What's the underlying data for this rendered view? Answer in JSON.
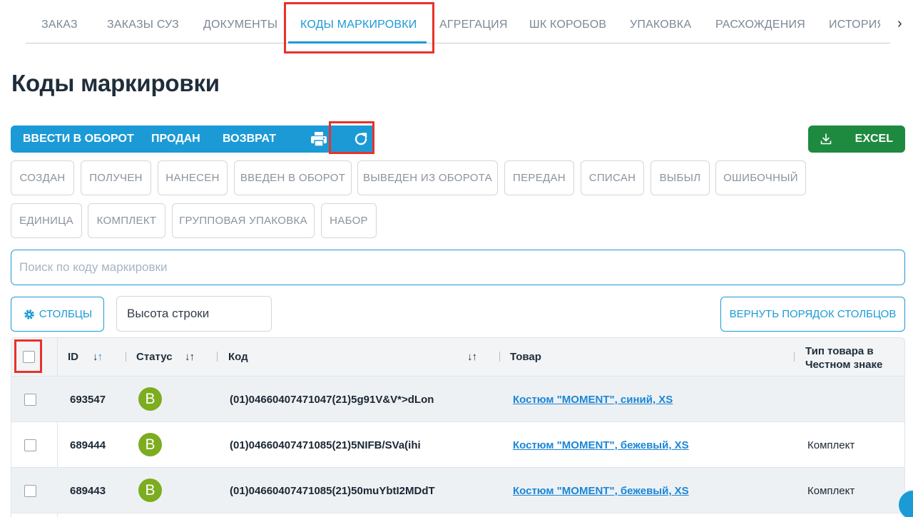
{
  "tabs": [
    {
      "label": "ЗАКАЗ"
    },
    {
      "label": "ЗАКАЗЫ СУЗ"
    },
    {
      "label": "ДОКУМЕНТЫ"
    },
    {
      "label": "КОДЫ МАРКИРОВКИ",
      "active": true
    },
    {
      "label": "АГРЕГАЦИЯ"
    },
    {
      "label": "ШК КОРОБОВ"
    },
    {
      "label": "УПАКОВКА"
    },
    {
      "label": "РАСХОЖДЕНИЯ"
    },
    {
      "label": "ИСТОРИЯ И"
    }
  ],
  "page_title": "Коды маркировки",
  "actions": {
    "enter_circulation": "ВВЕСТИ В ОБОРОТ",
    "sold": "ПРОДАН",
    "return": "ВОЗВРАТ",
    "print_icon": "printer-icon",
    "refresh_icon": "refresh-icon"
  },
  "excel": {
    "label": "EXCEL",
    "icon": "download-icon"
  },
  "status_filters": [
    "СОЗДАН",
    "ПОЛУЧЕН",
    "НАНЕСЕН",
    "ВВЕДЕН В ОБОРОТ",
    "ВЫВЕДЕН ИЗ ОБОРОТА",
    "ПЕРЕДАН",
    "СПИСАН",
    "ВЫБЫЛ",
    "ОШИБОЧНЫЙ"
  ],
  "type_filters": [
    "ЕДИНИЦА",
    "КОМПЛЕКТ",
    "ГРУППОВАЯ УПАКОВКА",
    "НАБОР"
  ],
  "search": {
    "placeholder": "Поиск по коду маркировки",
    "value": ""
  },
  "columns_button": {
    "label": "СТОЛБЦЫ",
    "icon": "gear-icon"
  },
  "row_height": {
    "label": "Высота строки"
  },
  "reset_columns": {
    "label": "ВЕРНУТЬ ПОРЯДОК СТОЛБЦОВ"
  },
  "table": {
    "headers": {
      "id": "ID",
      "status": "Статус",
      "code": "Код",
      "product": "Товар",
      "type_line1": "Тип товара в",
      "type_line2": "Честном знаке"
    },
    "rows": [
      {
        "id": "693547",
        "status": "В",
        "code": "(01)04660407471047(21)5g91V&V*>dLon",
        "product": "Костюм \"MOMENT\", синий, XS",
        "type": ""
      },
      {
        "id": "689444",
        "status": "В",
        "code": "(01)04660407471085(21)5NIFB/SVa(ihi",
        "product": "Костюм \"MOMENT\", бежевый, XS",
        "type": "Комплект"
      },
      {
        "id": "689443",
        "status": "В",
        "code": "(01)04660407471085(21)50muYbtI2MDdT",
        "product": "Костюм \"MOMENT\", бежевый, XS",
        "type": "Комплект"
      }
    ]
  },
  "colors": {
    "accent": "#1b9ad6",
    "excel": "#1d8a3f",
    "status_ok": "#7cac1f",
    "highlight": "#e8322a"
  }
}
